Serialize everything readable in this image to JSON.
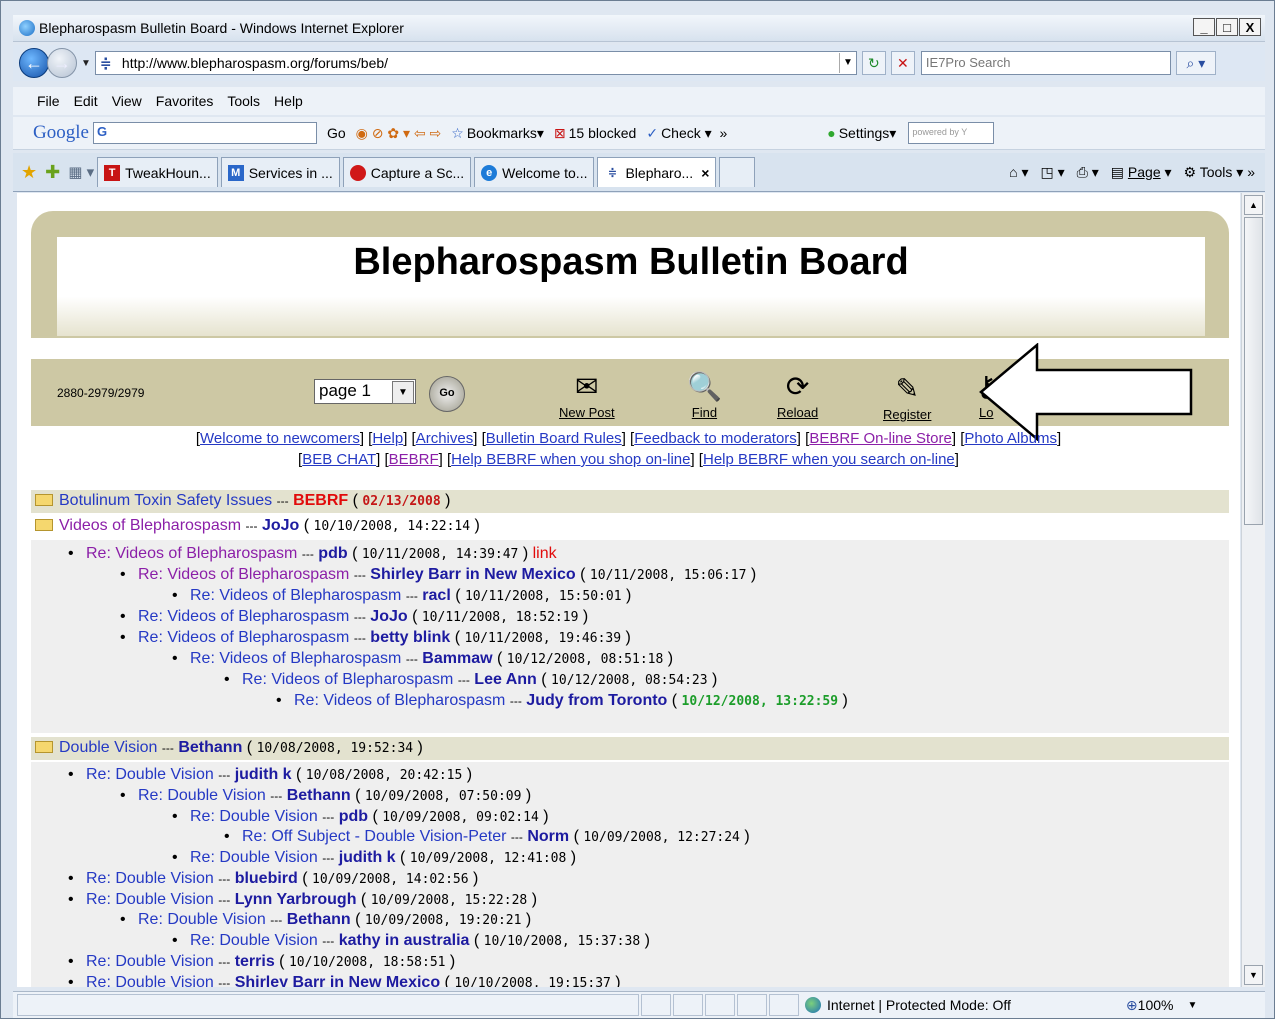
{
  "window": {
    "title": "Blepharospasm Bulletin Board - Windows Internet Explorer",
    "min": "_",
    "max": "□",
    "close": "X"
  },
  "address": {
    "url": "http://www.blepharospasm.org/forums/beb/",
    "search_placeholder": "IE7Pro Search"
  },
  "menu": {
    "file": "File",
    "edit": "Edit",
    "view": "View",
    "favorites": "Favorites",
    "tools": "Tools",
    "help": "Help"
  },
  "googlebar": {
    "logo": "Google",
    "box": "G",
    "go": "Go",
    "bookmarks": "Bookmarks",
    "blocked": "15 blocked",
    "check": "Check",
    "settings": "Settings",
    "powered": "powered by Y"
  },
  "tabs": [
    {
      "label": "TweakHoun...",
      "icon_text": "T",
      "color": "#c81414"
    },
    {
      "label": "Services in ...",
      "icon_text": "M",
      "color": "#2a67c9"
    },
    {
      "label": "Capture a Sc...",
      "icon_text": "",
      "color": "#d01818"
    },
    {
      "label": "Welcome to...",
      "icon_text": "e",
      "color": "#1d7bd8"
    },
    {
      "label": "Blepharo...",
      "icon_text": "",
      "color": "#2a4ea0"
    }
  ],
  "command": {
    "page": "Page",
    "tools": "Tools"
  },
  "board": {
    "title": "Blepharospasm Bulletin Board",
    "counter": "2880-2979/2979",
    "page_select": "page 1",
    "go": "Go",
    "nav": {
      "new_post": "New Post",
      "find": "Find",
      "reload": "Reload",
      "register": "Register",
      "login": "Lo"
    }
  },
  "links_row1": [
    "Welcome to newcomers",
    "Help",
    "Archives",
    "Bulletin Board Rules",
    "Feedback to moderators",
    "BEBRF On-line Store",
    "Photo Albums"
  ],
  "links_row2": [
    "BEB CHAT",
    "BEBRF",
    "Help BEBRF when you shop on-line",
    "Help BEBRF when you search on-line"
  ],
  "threads": {
    "t1": {
      "subject": "Botulinum Toxin Safety Issues",
      "author": "BEBRF",
      "date": "02/13/2008"
    },
    "t2": {
      "subject": "Videos of Blepharospasm",
      "author": "JoJo",
      "date": "10/10/2008, 14:22:14"
    },
    "t2r": [
      {
        "subject": "Re: Videos of Blepharospasm",
        "author": "pdb",
        "date": "10/11/2008, 14:39:47",
        "extra": "link"
      },
      {
        "subject": "Re: Videos of Blepharospasm",
        "author": "Shirley Barr in New Mexico",
        "date": "10/11/2008, 15:06:17"
      },
      {
        "subject": "Re: Videos of Blepharospasm",
        "author": "racl",
        "date": "10/11/2008, 15:50:01"
      },
      {
        "subject": "Re: Videos of Blepharospasm",
        "author": "JoJo",
        "date": "10/11/2008, 18:52:19"
      },
      {
        "subject": "Re: Videos of Blepharospasm",
        "author": "betty blink",
        "date": "10/11/2008, 19:46:39"
      },
      {
        "subject": "Re: Videos of Blepharospasm",
        "author": "Bammaw",
        "date": "10/12/2008, 08:51:18"
      },
      {
        "subject": "Re: Videos of Blepharospasm",
        "author": "Lee Ann",
        "date": "10/12/2008, 08:54:23"
      },
      {
        "subject": "Re: Videos of Blepharospasm",
        "author": "Judy from Toronto",
        "date": "10/12/2008, 13:22:59"
      }
    ],
    "t3": {
      "subject": "Double Vision",
      "author": "Bethann",
      "date": "10/08/2008, 19:52:34"
    },
    "t3r": [
      {
        "subject": "Re: Double Vision",
        "author": "judith k",
        "date": "10/08/2008, 20:42:15"
      },
      {
        "subject": "Re: Double Vision",
        "author": "Bethann",
        "date": "10/09/2008, 07:50:09"
      },
      {
        "subject": "Re: Double Vision",
        "author": "pdb",
        "date": "10/09/2008, 09:02:14"
      },
      {
        "subject": "Re: Off Subject - Double Vision-Peter",
        "author": "Norm",
        "date": "10/09/2008, 12:27:24"
      },
      {
        "subject": "Re: Double Vision",
        "author": "judith k",
        "date": "10/09/2008, 12:41:08"
      },
      {
        "subject": "Re: Double Vision",
        "author": "bluebird",
        "date": "10/09/2008, 14:02:56"
      },
      {
        "subject": "Re: Double Vision",
        "author": "Lynn Yarbrough",
        "date": "10/09/2008, 15:22:28"
      },
      {
        "subject": "Re: Double Vision",
        "author": "Bethann",
        "date": "10/09/2008, 19:20:21"
      },
      {
        "subject": "Re: Double Vision",
        "author": "kathy in australia",
        "date": "10/10/2008, 15:37:38"
      },
      {
        "subject": "Re: Double Vision",
        "author": "terris",
        "date": "10/10/2008, 18:58:51"
      },
      {
        "subject": "Re: Double Vision",
        "author": "Shirley Barr in New Mexico",
        "date": "10/10/2008, 19:15:37"
      }
    ]
  },
  "status": {
    "zone": "Internet | Protected Mode: Off",
    "zoom": "100%"
  }
}
